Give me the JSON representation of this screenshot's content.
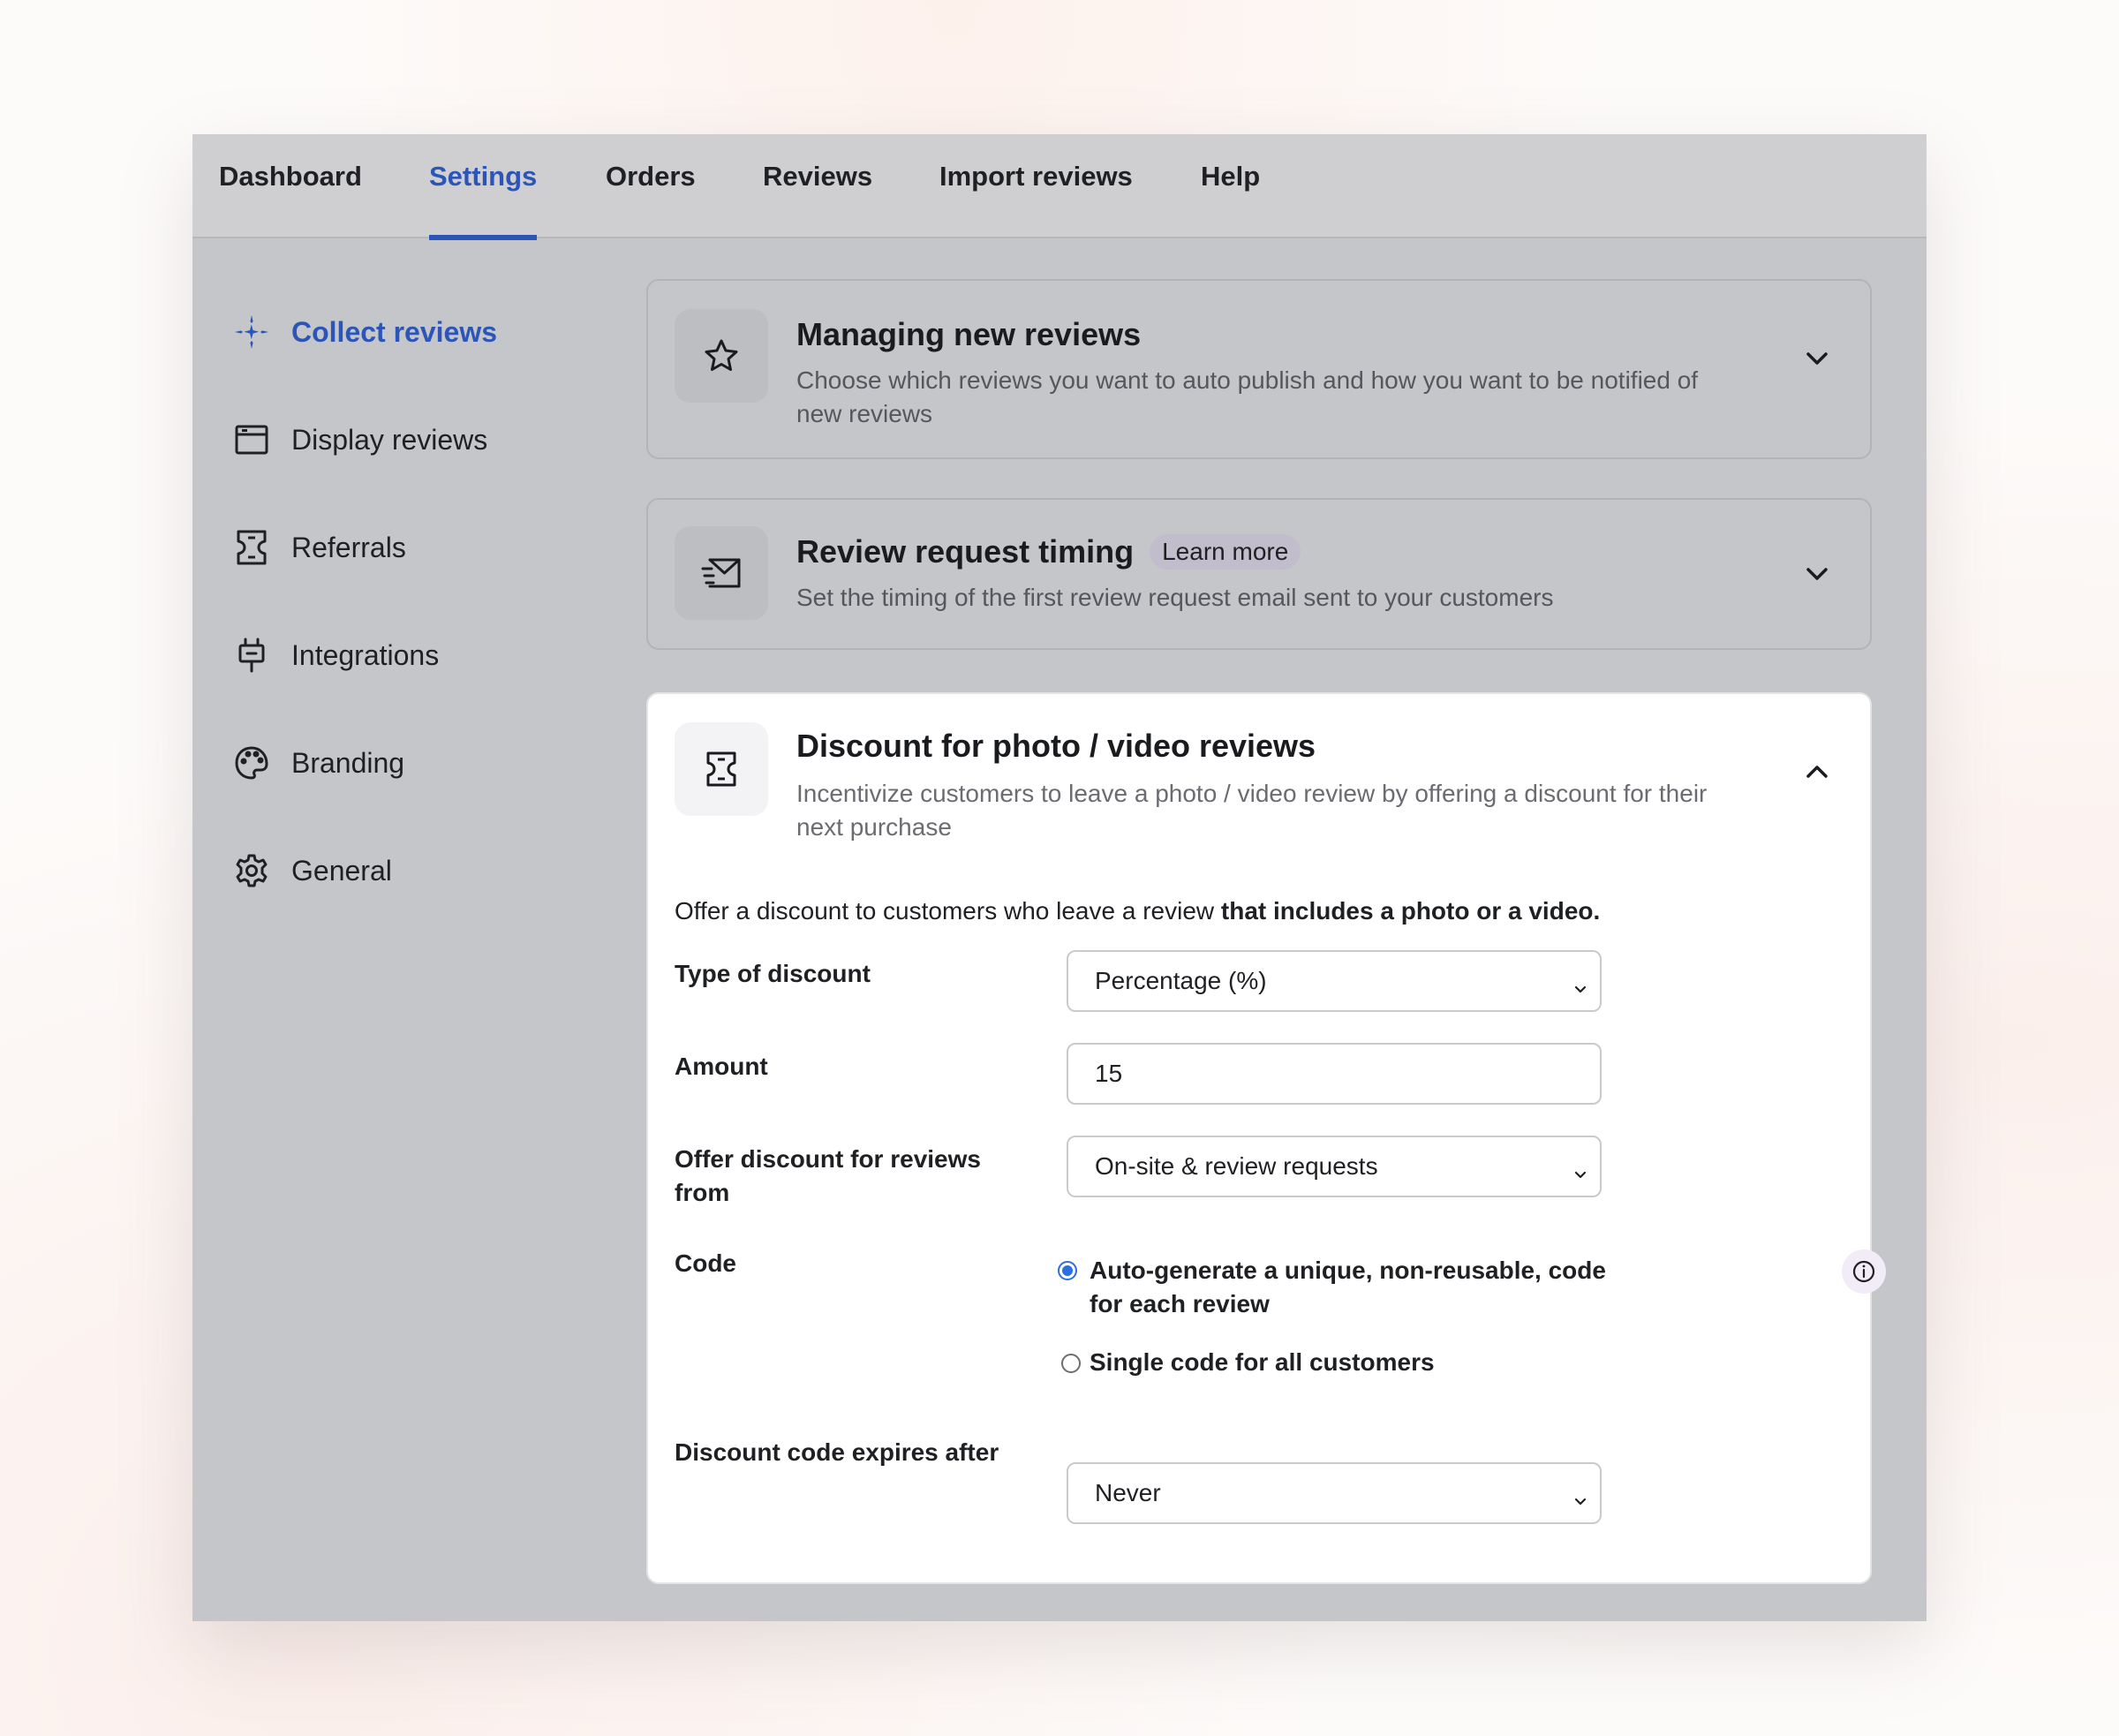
{
  "nav": {
    "tabs": [
      {
        "label": "Dashboard"
      },
      {
        "label": "Settings"
      },
      {
        "label": "Orders"
      },
      {
        "label": "Reviews"
      },
      {
        "label": "Import reviews"
      },
      {
        "label": "Help"
      }
    ],
    "active_tab": "Settings"
  },
  "sidebar": {
    "items": [
      {
        "label": "Collect reviews",
        "icon": "sparkle-icon"
      },
      {
        "label": "Display reviews",
        "icon": "browser-window-icon"
      },
      {
        "label": "Referrals",
        "icon": "ticket-icon"
      },
      {
        "label": "Integrations",
        "icon": "plug-icon"
      },
      {
        "label": "Branding",
        "icon": "palette-icon"
      },
      {
        "label": "General",
        "icon": "gear-icon"
      }
    ],
    "active_item": "Collect reviews"
  },
  "cards": {
    "managing": {
      "icon": "star-icon",
      "title": "Managing new reviews",
      "description": "Choose which reviews you want to auto publish and how you want to be notified of new reviews"
    },
    "timing": {
      "icon": "envelope-send-icon",
      "title": "Review request timing",
      "badge": "Learn more",
      "description": "Set the timing of the first review request email sent to your customers"
    },
    "discount": {
      "icon": "ticket-icon",
      "title": "Discount for photo / video reviews",
      "description": "Incentivize customers to leave a photo / video review by offering a discount for their next purchase",
      "intro_prefix": "Offer a discount to customers who leave a review ",
      "intro_bold": "that includes a photo or a video.",
      "form": {
        "type_label": "Type of discount",
        "type_value": "Percentage (%)",
        "amount_label": "Amount",
        "amount_value": "15",
        "source_label": "Offer discount for reviews from",
        "source_value": "On-site & review requests",
        "code_label": "Code",
        "code_option_1": "Auto-generate a unique, non-reusable, code for each review",
        "code_option_2": "Single code for all customers",
        "code_selected": "Auto-generate a unique, non-reusable, code for each review",
        "expires_label": "Discount code expires after",
        "expires_value": "Never"
      }
    }
  },
  "colors": {
    "accent": "#2c55b8",
    "radio_accent": "#2c6fe0",
    "app_background": "#c5c6c9"
  }
}
